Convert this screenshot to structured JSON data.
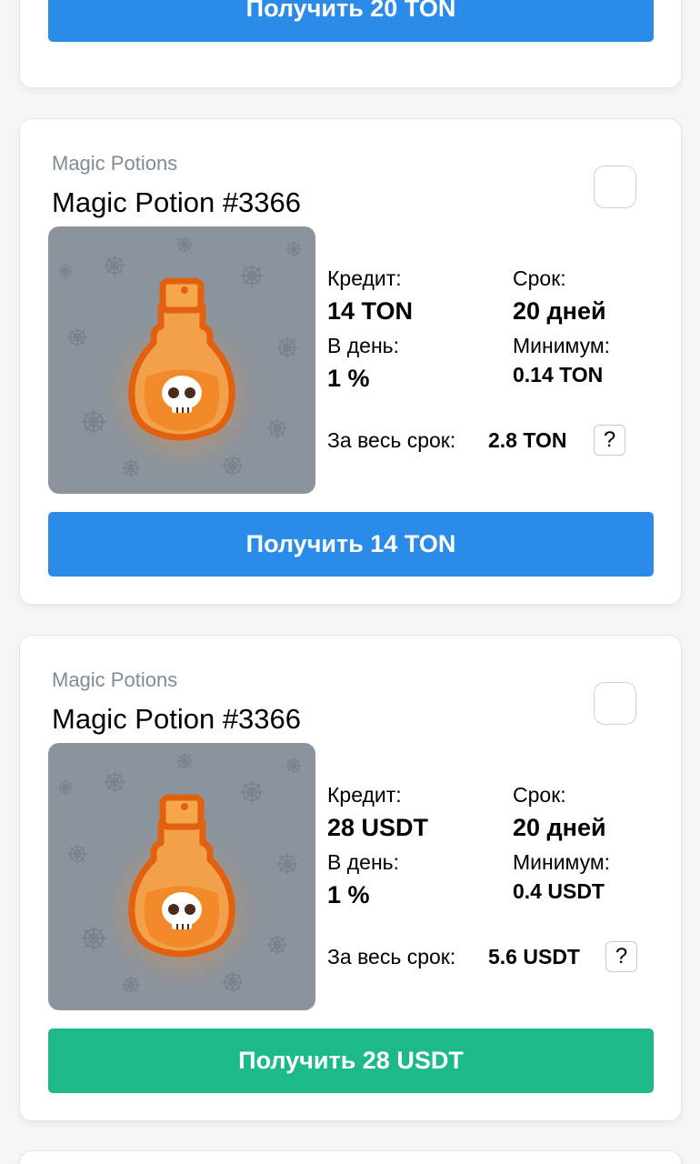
{
  "top_card": {
    "button_label": "Получить 20 TON",
    "button_color": "#2a8ce8"
  },
  "cards": [
    {
      "collection": "Magic Potions",
      "title": "Magic Potion #3366",
      "credit_label": "Кредит:",
      "credit_value": "14 TON",
      "term_label": "Срок:",
      "term_value": "20 дней",
      "per_day_label": "В день:",
      "per_day_value": "1 %",
      "minimum_label": "Минимум:",
      "minimum_value": "0.14 TON",
      "total_label": "За весь срок:",
      "total_value": "2.8 TON",
      "help_label": "?",
      "button_label": "Получить 14 TON",
      "button_color": "#2a8ce8",
      "image_icon": "potion-bottle-skull"
    },
    {
      "collection": "Magic Potions",
      "title": "Magic Potion #3366",
      "credit_label": "Кредит:",
      "credit_value": "28 USDT",
      "term_label": "Срок:",
      "term_value": "20 дней",
      "per_day_label": "В день:",
      "per_day_value": "1 %",
      "minimum_label": "Минимум:",
      "minimum_value": "0.4 USDT",
      "total_label": "За весь срок:",
      "total_value": "5.6 USDT",
      "help_label": "?",
      "button_label": "Получить 28 USDT",
      "button_color": "#1db98a",
      "image_icon": "potion-bottle-skull"
    }
  ]
}
